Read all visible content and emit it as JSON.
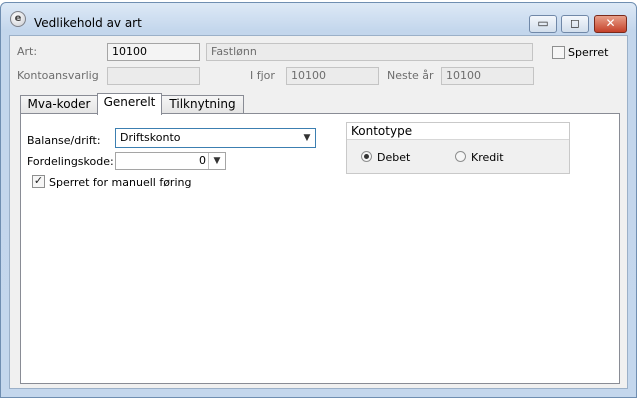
{
  "window": {
    "title": "Vedlikehold av art",
    "app_icon_glyph": "e",
    "minimize_glyph": "▭",
    "maximize_glyph": "◻",
    "close_glyph": "✕"
  },
  "header": {
    "art_label": "Art:",
    "art_value": "10100",
    "art_name": "Fastlønn",
    "sperret_label": "Sperret",
    "sperret_checked": false,
    "kontoansvarlig_label": "Kontoansvarlig",
    "kontoansvarlig_value": "",
    "ifjor_label": "I fjor",
    "ifjor_value": "10100",
    "neste_aar_label": "Neste år",
    "neste_aar_value": "10100"
  },
  "tabs": [
    {
      "label": "Mva-koder"
    },
    {
      "label": "Generelt"
    },
    {
      "label": "Tilknytning"
    }
  ],
  "generelt": {
    "balanse_label": "Balanse/drift:",
    "balanse_value": "Driftskonto",
    "fordeling_label": "Fordelingskode:",
    "fordeling_value": "0",
    "sperret_manuell_label": "Sperret for manuell føring",
    "sperret_manuell_checked": true,
    "kontotype_title": "Kontotype",
    "kontotype_options": [
      {
        "label": "Debet",
        "selected": true
      },
      {
        "label": "Kredit",
        "selected": false
      }
    ]
  },
  "colors": {
    "title_bar": "#c4d7ed",
    "close_button": "#c5412a",
    "focus_border": "#3c7fb1"
  }
}
